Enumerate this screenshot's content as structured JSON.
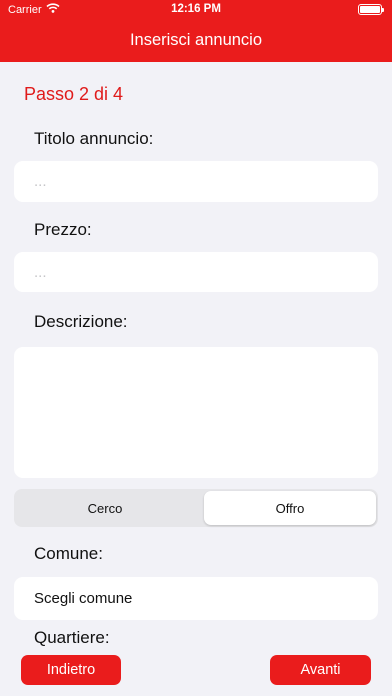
{
  "status_bar": {
    "carrier": "Carrier",
    "time": "12:16 PM"
  },
  "header": {
    "title": "Inserisci annuncio"
  },
  "step": {
    "label": "Passo 2 di 4"
  },
  "form": {
    "title_label": "Titolo annuncio:",
    "title_placeholder": "...",
    "price_label": "Prezzo:",
    "price_placeholder": "...",
    "description_label": "Descrizione:",
    "description_value": "",
    "segment": {
      "options": [
        "Cerco",
        "Offro"
      ],
      "selected": "Offro"
    },
    "comune_label": "Comune:",
    "comune_value": "Scegli comune",
    "quartiere_label": "Quartiere:"
  },
  "footer": {
    "back_label": "Indietro",
    "next_label": "Avanti"
  },
  "colors": {
    "accent": "#ea1c1c",
    "background": "#f2f2f7",
    "field": "#ffffff"
  }
}
